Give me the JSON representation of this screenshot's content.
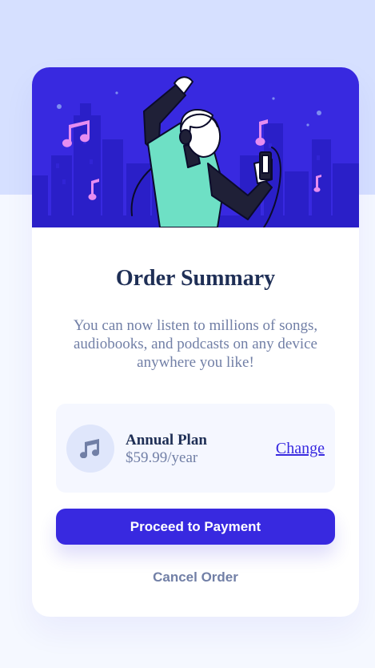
{
  "colors": {
    "page_background": "#f5f8ff",
    "background_top": "#d6e0ff",
    "hero_background": "#3829e0",
    "heading": "#1f2f56",
    "text_muted": "#717fa6",
    "accent": "#3829e0",
    "plan_box": "#f5f7ff"
  },
  "hero": {
    "icons": [
      "music-note-icon",
      "music-note-icon",
      "music-note-icon",
      "music-note-icon"
    ]
  },
  "summary": {
    "title": "Order Summary",
    "description": "You can now listen to millions of songs, audiobooks, and podcasts on any device anywhere you like!"
  },
  "plan": {
    "icon": "music-note-icon",
    "name": "Annual Plan",
    "price": "$59.99/year",
    "change_label": "Change"
  },
  "actions": {
    "proceed_label": "Proceed to Payment",
    "cancel_label": "Cancel Order"
  }
}
